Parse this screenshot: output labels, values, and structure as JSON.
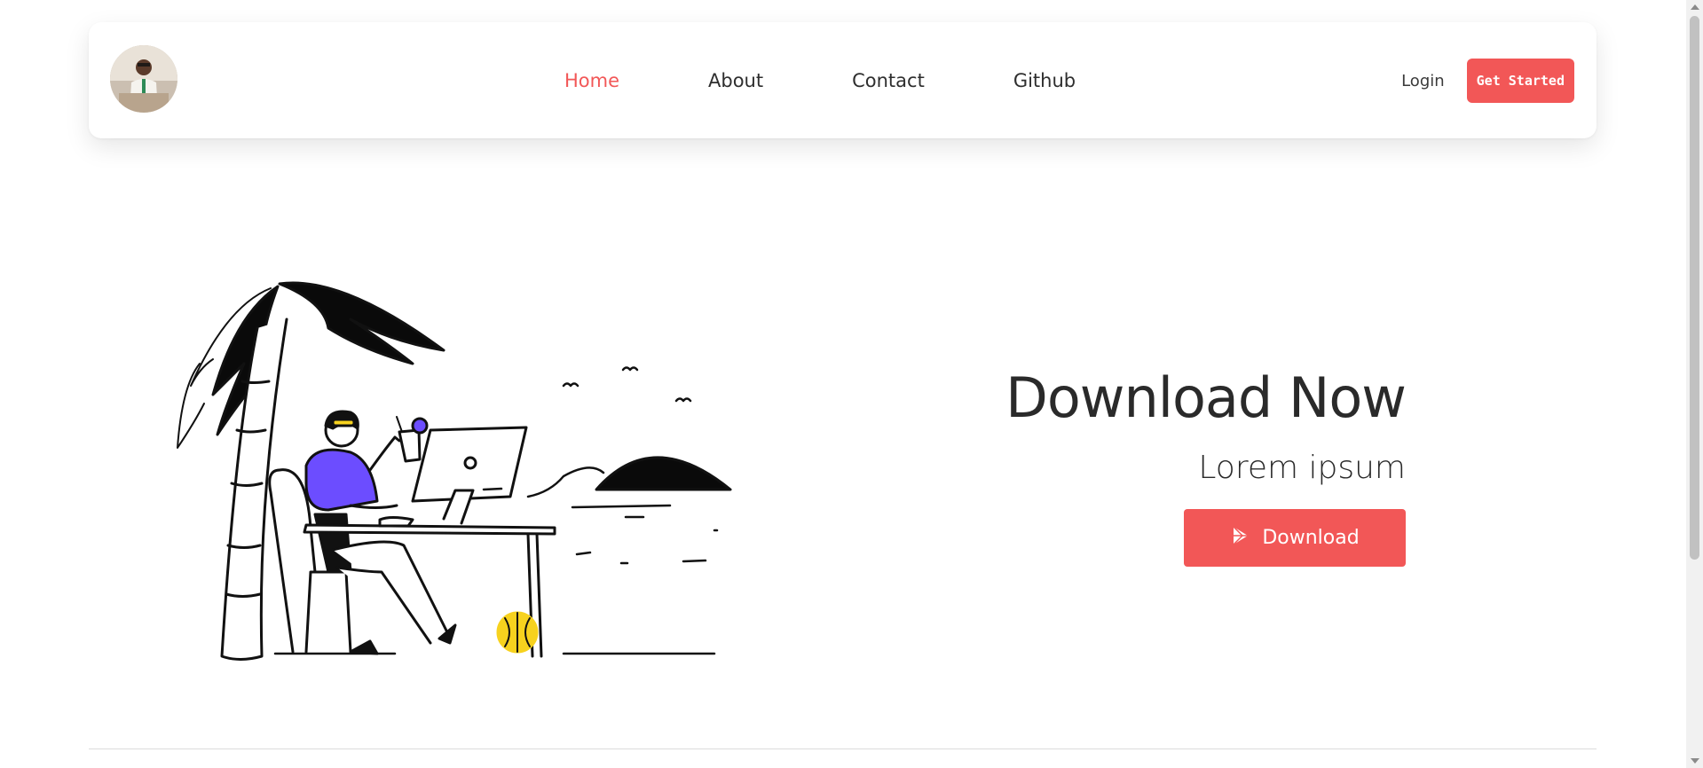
{
  "nav": {
    "links": [
      {
        "label": "Home",
        "active": true
      },
      {
        "label": "About",
        "active": false
      },
      {
        "label": "Contact",
        "active": false
      },
      {
        "label": "Github",
        "active": false
      }
    ],
    "login_label": "Login",
    "cta_label": "Get Started"
  },
  "hero": {
    "title": "Download Now",
    "subtitle": "Lorem ipsum",
    "download_label": "Download",
    "download_icon": "play-store-icon"
  },
  "colors": {
    "accent": "#f25757",
    "text": "#2a2a2a",
    "illustration_shirt": "#6c4dff",
    "illustration_ball": "#f7d21e"
  }
}
